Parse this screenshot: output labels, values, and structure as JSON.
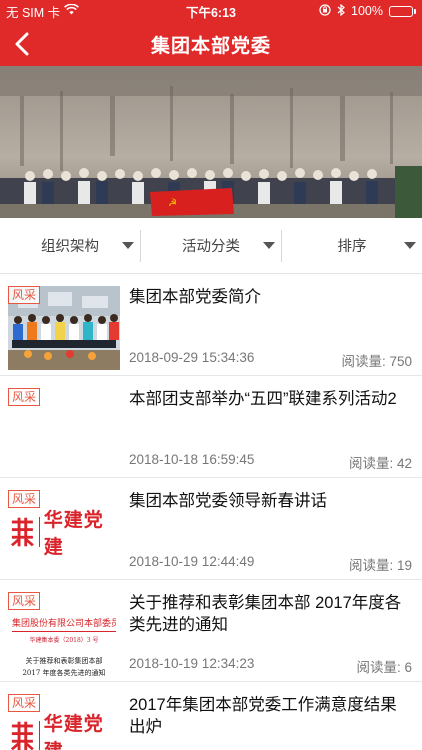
{
  "status": {
    "carrier": "无 SIM 卡",
    "time": "下午6:13",
    "battery": "100%"
  },
  "nav": {
    "title": "集团本部党委"
  },
  "filters": [
    {
      "label": "组织架构"
    },
    {
      "label": "活动分类"
    },
    {
      "label": "排序"
    }
  ],
  "articles": [
    {
      "tag": "风采",
      "title": "集团本部党委简介",
      "date": "2018-09-29 15:34:36",
      "reads": "阅读量: 750"
    },
    {
      "tag": "风采",
      "title": "本部团支部举办“五四”联建系列活动2",
      "date": "2018-10-18 16:59:45",
      "reads": "阅读量: 42"
    },
    {
      "tag": "风采",
      "title": "集团本部党委领导新春讲话",
      "date": "2018-10-19 12:44:49",
      "reads": "阅读量: 19",
      "logo_text": "华建党建"
    },
    {
      "tag": "风采",
      "title": "关于推荐和表彰集团本部 2017年度各类先进的通知",
      "date": "2018-10-19 12:34:23",
      "reads": "阅读量: 6",
      "doc_lines": [
        "集团股份有限公司本部委员会",
        "华建集本委（2018）3 号",
        "关于推荐和表彰集团本部",
        "2017 年度各类先进的通知"
      ]
    },
    {
      "tag": "风采",
      "title": "2017年集团本部党委工作满意度结果出炉",
      "logo_text": "华建党建"
    }
  ],
  "colors": {
    "brand_red": "#e02a2a",
    "tag_red": "#e8573f"
  }
}
